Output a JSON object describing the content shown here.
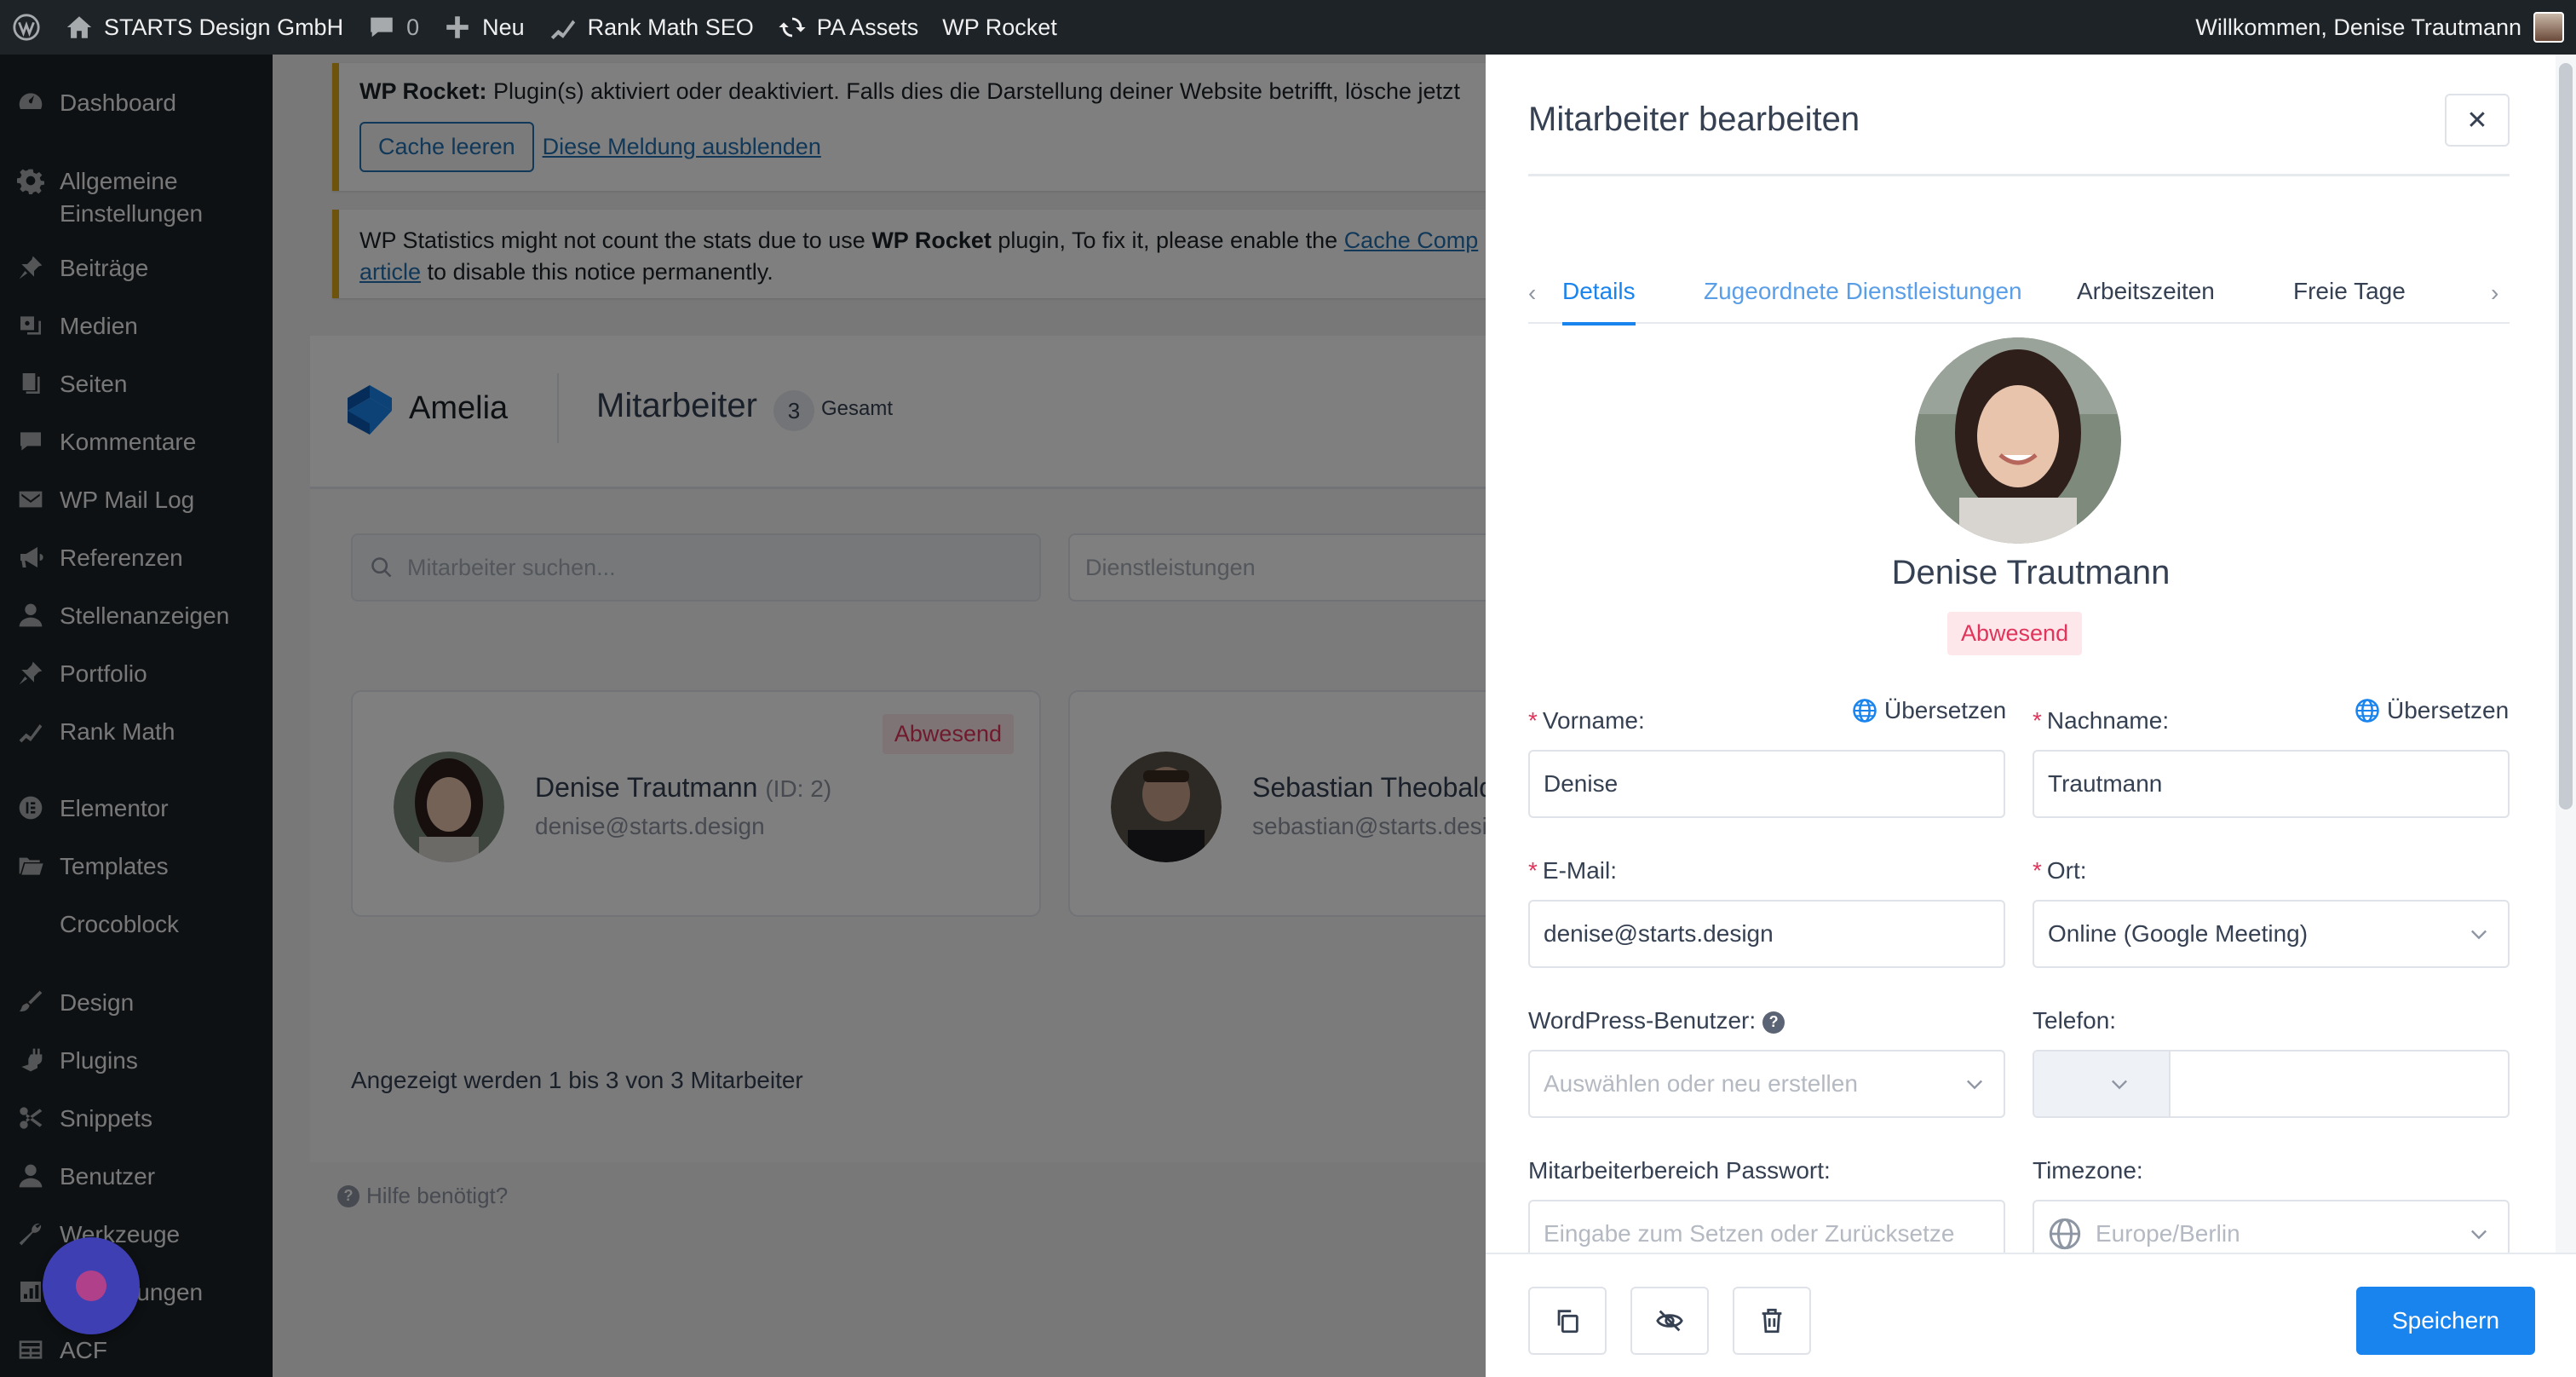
{
  "adminbar": {
    "site_name": "STARTS Design GmbH",
    "comments_count": "0",
    "new_label": "Neu",
    "rankmath_label": "Rank Math SEO",
    "pa_assets_label": "PA Assets",
    "wprocket_label": "WP Rocket",
    "welcome": "Willkommen, Denise Trautmann"
  },
  "sidebar": {
    "items": [
      {
        "label": "Dashboard",
        "icon": "dashboard-icon"
      },
      {
        "label": "Allgemeine Einstellungen",
        "icon": "gear-icon"
      },
      {
        "label": "Beiträge",
        "icon": "pin-icon"
      },
      {
        "label": "Medien",
        "icon": "media-icon"
      },
      {
        "label": "Seiten",
        "icon": "pages-icon"
      },
      {
        "label": "Kommentare",
        "icon": "comment-icon"
      },
      {
        "label": "WP Mail Log",
        "icon": "mail-icon"
      },
      {
        "label": "Referenzen",
        "icon": "megaphone-icon"
      },
      {
        "label": "Stellenanzeigen",
        "icon": "user-icon"
      },
      {
        "label": "Portfolio",
        "icon": "pin-icon"
      },
      {
        "label": "Rank Math",
        "icon": "rankmath-icon"
      },
      {
        "label": "Elementor",
        "icon": "elementor-icon"
      },
      {
        "label": "Templates",
        "icon": "folder-icon"
      },
      {
        "label": "Crocoblock",
        "icon": "crocoblock-icon"
      },
      {
        "label": "Design",
        "icon": "brush-icon"
      },
      {
        "label": "Plugins",
        "icon": "plugin-icon"
      },
      {
        "label": "Snippets",
        "icon": "scissors-icon"
      },
      {
        "label": "Benutzer",
        "icon": "user-icon"
      },
      {
        "label": "Werkzeuge",
        "icon": "wrench-icon"
      },
      {
        "label": "Einstellungen",
        "icon": "settings-icon"
      },
      {
        "label": "ACF",
        "icon": "table-icon"
      }
    ]
  },
  "notices": {
    "rocket_bold": "WP Rocket:",
    "rocket_text": "Plugin(s) aktiviert oder deaktiviert. Falls dies die Darstellung deiner Website betrifft, lösche jetzt",
    "clear_cache": "Cache leeren",
    "dismiss": "Diese Meldung ausblenden",
    "stats_text_1": "WP Statistics might not count the stats due to use",
    "stats_bold": "WP Rocket",
    "stats_text_2": "plugin, To fix it, please enable the",
    "stats_link": "Cache Comp",
    "stats_link_2": "article",
    "stats_text_3": "to disable this notice permanently."
  },
  "amelia": {
    "brand": "Amelia",
    "page_title": "Mitarbeiter",
    "count": "3",
    "count_label": "Gesamt",
    "search_placeholder": "Mitarbeiter suchen...",
    "services_placeholder": "Dienstleistungen",
    "footer_text": "Angezeigt werden 1 bis 3 von 3 Mitarbeiter",
    "help": "Hilfe benötigt?",
    "employees": [
      {
        "name": "Denise Trautmann",
        "id": "(ID: 2)",
        "email": "denise@starts.design",
        "status": "Abwesend"
      },
      {
        "name": "Sebastian Theobald",
        "email": "sebastian@starts.design"
      }
    ]
  },
  "drawer": {
    "title": "Mitarbeiter bearbeiten",
    "tabs": [
      "Details",
      "Zugeordnete Dienstleistungen",
      "Arbeitszeiten",
      "Freie Tage"
    ],
    "profile_name": "Denise Trautmann",
    "profile_status": "Abwesend",
    "translate": "Übersetzen",
    "fields": {
      "firstname_label": "Vorname:",
      "firstname_value": "Denise",
      "lastname_label": "Nachname:",
      "lastname_value": "Trautmann",
      "email_label": "E-Mail:",
      "email_value": "denise@starts.design",
      "location_label": "Ort:",
      "location_value": "Online  (Google Meeting)",
      "wpuser_label": "WordPress-Benutzer:",
      "wpuser_placeholder": "Auswählen oder neu erstellen",
      "phone_label": "Telefon:",
      "password_label": "Mitarbeiterbereich Passwort:",
      "password_placeholder": "Eingabe zum Setzen oder Zurücksetze",
      "timezone_label": "Timezone:",
      "timezone_placeholder": "Europe/Berlin"
    },
    "save": "Speichern"
  },
  "colors": {
    "primary": "#1a84ee",
    "danger": "#e1345b",
    "admin_dark": "#1d2327"
  }
}
